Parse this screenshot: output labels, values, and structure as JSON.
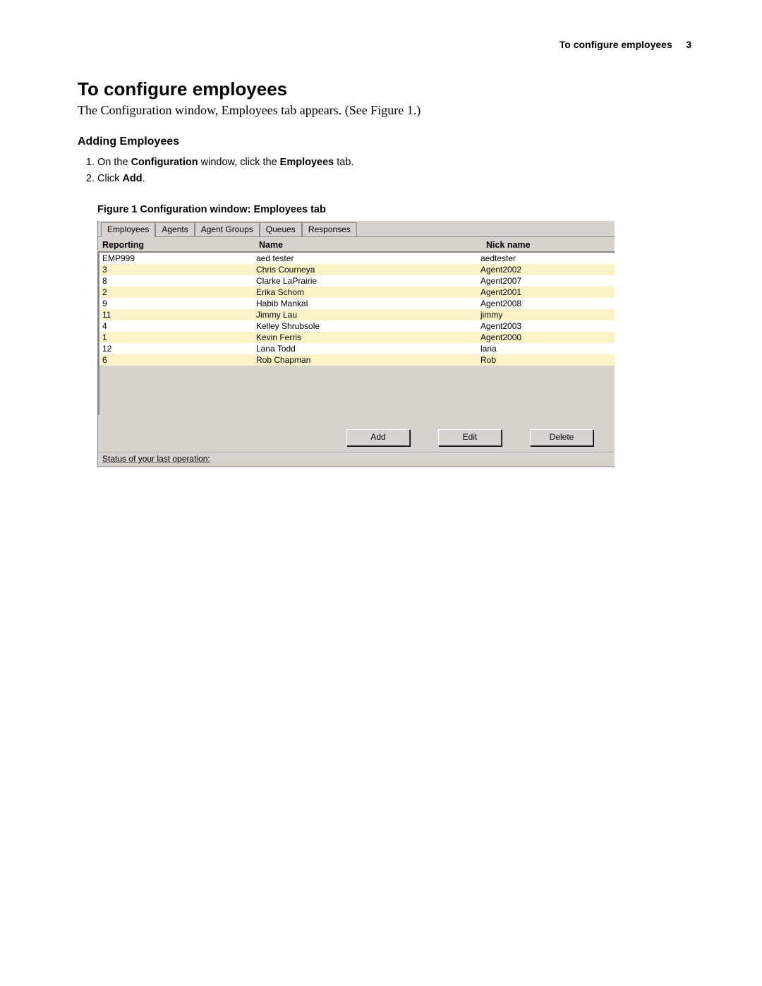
{
  "header": {
    "title": "To configure employees",
    "page_number": "3"
  },
  "title": "To configure employees",
  "intro": "The Configuration window, Employees tab appears. (See Figure 1.)",
  "section_heading": "Adding Employees",
  "steps": {
    "s1_a": "On the ",
    "s1_b": "Configuration",
    "s1_c": " window, click the ",
    "s1_d": "Employees",
    "s1_e": " tab.",
    "s2_a": "Click ",
    "s2_b": "Add",
    "s2_c": "."
  },
  "figure_caption": "Figure 1   Configuration window: Employees tab",
  "window": {
    "tabs": [
      "Employees",
      "Agents",
      "Agent Groups",
      "Queues",
      "Responses"
    ],
    "columns": {
      "reporting": "Reporting",
      "name": "Name",
      "nick": "Nick name"
    },
    "rows": [
      {
        "reporting": "EMP999",
        "name": "aed tester",
        "nick": "aedtester"
      },
      {
        "reporting": "3",
        "name": "Chris Courneya",
        "nick": "Agent2002"
      },
      {
        "reporting": "8",
        "name": "Clarke LaPrairie",
        "nick": "Agent2007"
      },
      {
        "reporting": "2",
        "name": "Erika Schom",
        "nick": "Agent2001"
      },
      {
        "reporting": "9",
        "name": "Habib Mankal",
        "nick": "Agent2008"
      },
      {
        "reporting": "11",
        "name": "Jimmy Lau",
        "nick": "jimmy"
      },
      {
        "reporting": "4",
        "name": "Kelley Shrubsole",
        "nick": "Agent2003"
      },
      {
        "reporting": "1",
        "name": "Kevin Ferris",
        "nick": "Agent2000"
      },
      {
        "reporting": "12",
        "name": "Lana Todd",
        "nick": "lana"
      },
      {
        "reporting": "6",
        "name": "Rob Chapman",
        "nick": "Rob"
      }
    ],
    "buttons": {
      "add": "Add",
      "edit": "Edit",
      "delete": "Delete"
    },
    "status": "Status of your last operation:"
  }
}
